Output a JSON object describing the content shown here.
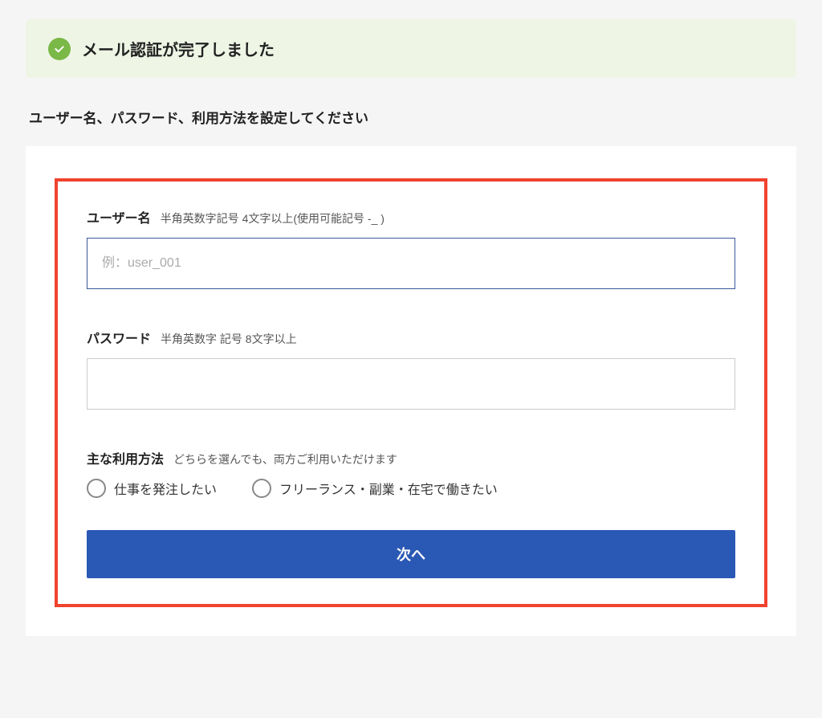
{
  "banner": {
    "text": "メール認証が完了しました"
  },
  "instruction": "ユーザー名、パスワード、利用方法を設定してください",
  "form": {
    "username": {
      "label": "ユーザー名",
      "hint": "半角英数字記号 4文字以上(使用可能記号 -_ )",
      "placeholder": "例：user_001",
      "value": ""
    },
    "password": {
      "label": "パスワード",
      "hint": "半角英数字 記号 8文字以上",
      "value": ""
    },
    "usage": {
      "label": "主な利用方法",
      "hint": "どちらを選んでも、両方ご利用いただけます",
      "options": {
        "client": "仕事を発注したい",
        "worker": "フリーランス・副業・在宅で働きたい"
      }
    },
    "next_button": "次へ"
  }
}
